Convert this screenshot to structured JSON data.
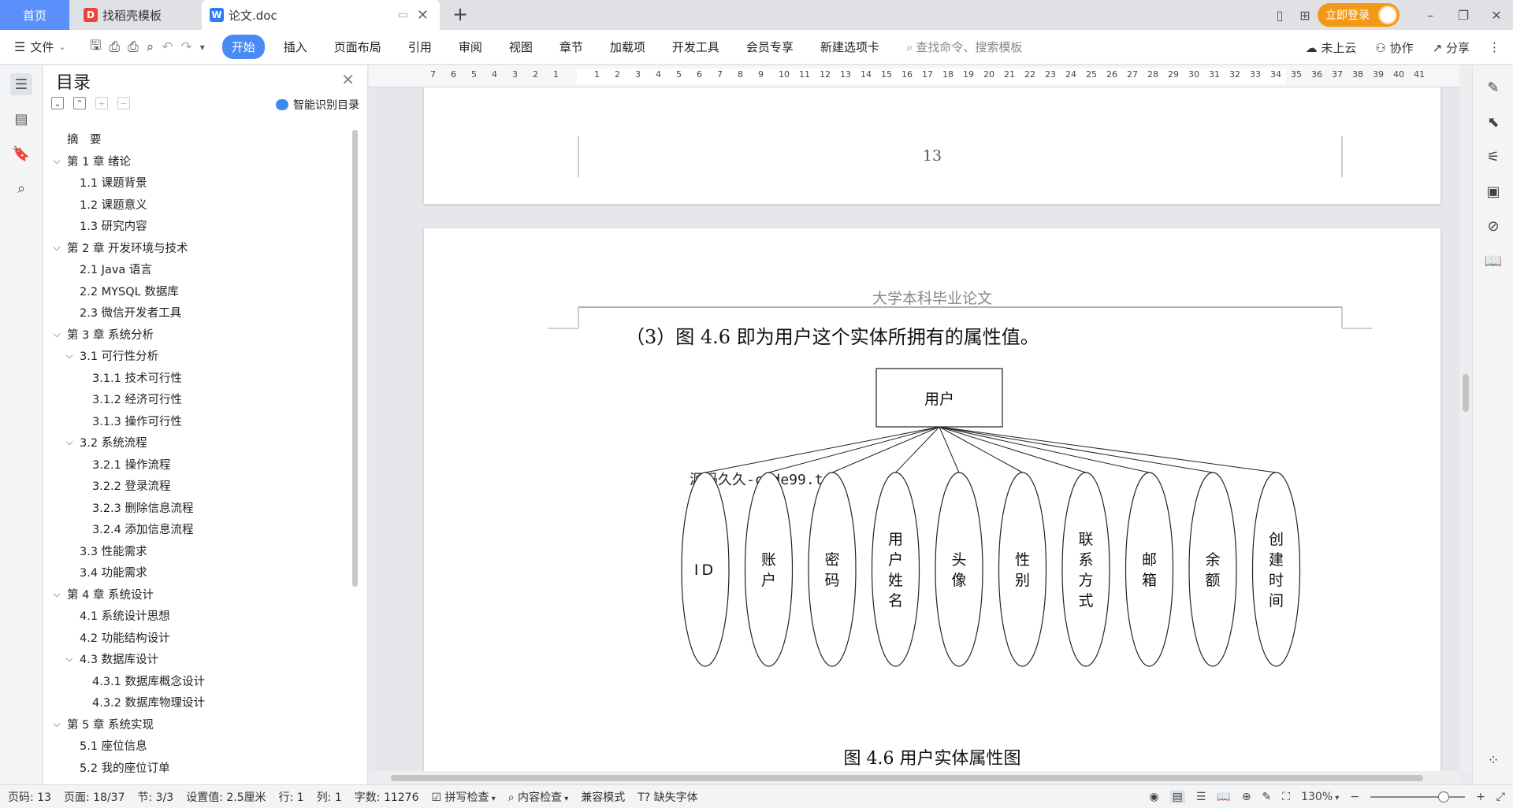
{
  "tabs": {
    "home": "首页",
    "template": "找稻壳模板",
    "doc": "论文.doc"
  },
  "topbar": {
    "login": "立即登录"
  },
  "menu": {
    "file": "文件",
    "items": [
      "开始",
      "插入",
      "页面布局",
      "引用",
      "审阅",
      "视图",
      "章节",
      "加载项",
      "开发工具",
      "会员专享",
      "新建选项卡"
    ],
    "search_placeholder": "查找命令、搜索模板",
    "cloud": "未上云",
    "collab": "协作",
    "share": "分享"
  },
  "toc": {
    "title": "目录",
    "smart": "智能识别目录",
    "items": [
      {
        "text": "摘　要",
        "level": 1,
        "caret": ""
      },
      {
        "text": "第 1 章  绪论",
        "level": 1,
        "caret": "v"
      },
      {
        "text": "1.1  课题背景",
        "level": 2,
        "caret": ""
      },
      {
        "text": "1.2  课题意义",
        "level": 2,
        "caret": ""
      },
      {
        "text": "1.3  研究内容",
        "level": 2,
        "caret": ""
      },
      {
        "text": "第 2 章  开发环境与技术",
        "level": 1,
        "caret": "v"
      },
      {
        "text": "2.1 Java 语言",
        "level": 2,
        "caret": ""
      },
      {
        "text": "2.2 MYSQL 数据库",
        "level": 2,
        "caret": ""
      },
      {
        "text": "2.3 微信开发者工具",
        "level": 2,
        "caret": ""
      },
      {
        "text": "第 3 章  系统分析",
        "level": 1,
        "caret": "v"
      },
      {
        "text": "3.1  可行性分析",
        "level": 2,
        "caret": "v"
      },
      {
        "text": "3.1.1  技术可行性",
        "level": 3,
        "caret": ""
      },
      {
        "text": "3.1.2  经济可行性",
        "level": 3,
        "caret": ""
      },
      {
        "text": "3.1.3  操作可行性",
        "level": 3,
        "caret": ""
      },
      {
        "text": "3.2  系统流程",
        "level": 2,
        "caret": "v"
      },
      {
        "text": "3.2.1  操作流程",
        "level": 3,
        "caret": ""
      },
      {
        "text": "3.2.2  登录流程",
        "level": 3,
        "caret": ""
      },
      {
        "text": "3.2.3  删除信息流程",
        "level": 3,
        "caret": ""
      },
      {
        "text": "3.2.4  添加信息流程",
        "level": 3,
        "caret": ""
      },
      {
        "text": "3.3  性能需求",
        "level": 2,
        "caret": ""
      },
      {
        "text": "3.4  功能需求",
        "level": 2,
        "caret": ""
      },
      {
        "text": "第 4 章  系统设计",
        "level": 1,
        "caret": "v"
      },
      {
        "text": "4.1  系统设计思想",
        "level": 2,
        "caret": ""
      },
      {
        "text": "4.2  功能结构设计",
        "level": 2,
        "caret": ""
      },
      {
        "text": "4.3  数据库设计",
        "level": 2,
        "caret": "v"
      },
      {
        "text": "4.3.1  数据库概念设计",
        "level": 3,
        "caret": ""
      },
      {
        "text": "4.3.2  数据库物理设计",
        "level": 3,
        "caret": ""
      },
      {
        "text": "第 5 章  系统实现",
        "level": 1,
        "caret": "v"
      },
      {
        "text": "5.1  座位信息",
        "level": 2,
        "caret": ""
      },
      {
        "text": "5.2  我的座位订单",
        "level": 2,
        "caret": ""
      }
    ]
  },
  "ruler": {
    "left_ticks": [
      "7",
      "6",
      "5",
      "4",
      "3",
      "2",
      "1"
    ],
    "right_ticks": [
      "1",
      "2",
      "3",
      "4",
      "5",
      "6",
      "7",
      "8",
      "9",
      "10",
      "11",
      "12",
      "13",
      "14",
      "15",
      "16",
      "17",
      "18",
      "19",
      "20",
      "21",
      "22",
      "23",
      "24",
      "25",
      "26",
      "27",
      "28",
      "29",
      "30",
      "31",
      "32",
      "33",
      "34",
      "35",
      "36",
      "37",
      "38",
      "39",
      "40",
      "41"
    ]
  },
  "document": {
    "page_number": "13",
    "header": "大学本科毕业论文",
    "paragraph": "（3）图 4.6 即为用户这个实体所拥有的属性值。",
    "watermark": "源码久久-code99.top",
    "entity": "用户",
    "attributes": [
      "ID",
      "账户",
      "密码",
      "用户姓名",
      "头像",
      "性别",
      "联系方式",
      "邮箱",
      "余额",
      "创建时间"
    ],
    "caption": "图 4.6  用户实体属性图"
  },
  "status": {
    "page": "页码: 13",
    "pages": "页面: 18/37",
    "section": "节: 3/3",
    "setting": "设置值: 2.5厘米",
    "row": "行: 1",
    "col": "列: 1",
    "words": "字数: 11276",
    "spell": "拼写检查",
    "content": "内容检查",
    "compat": "兼容模式",
    "font": "缺失字体",
    "zoom": "130%"
  }
}
